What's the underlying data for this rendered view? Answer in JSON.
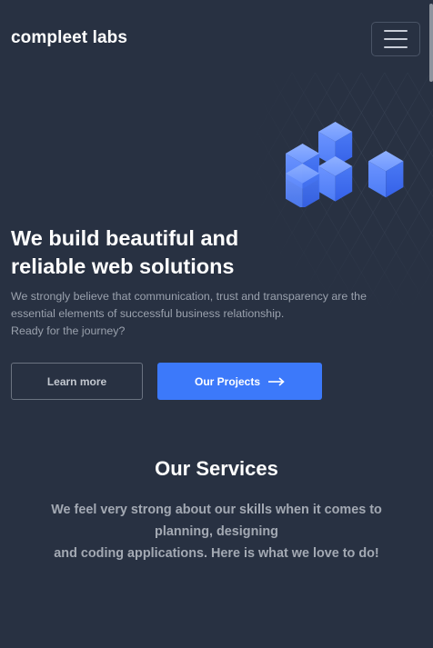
{
  "header": {
    "brand": "compleet labs",
    "menu_icon": "hamburger-icon"
  },
  "hero": {
    "title": "We build beautiful and reliable web solutions",
    "description_lines": [
      "We strongly believe that communication, trust and transparency are the essential elements of successful business relationship.",
      "Ready for the journey?"
    ],
    "illustration_icon": "isometric-cubes-illustration",
    "buttons": {
      "learn_more": "Learn more",
      "our_projects": "Our Projects",
      "arrow_icon": "arrow-right-icon"
    }
  },
  "services": {
    "title": "Our Services",
    "description_lines": [
      "We feel very strong about our skills when it comes to planning, designing",
      "and coding applications. Here is what we love to do!"
    ]
  },
  "colors": {
    "background": "#283142",
    "accent": "#3c79fa",
    "muted_text": "#9aa1ad",
    "cube_light": "#6f98ff",
    "cube_dark": "#3f6df2"
  }
}
